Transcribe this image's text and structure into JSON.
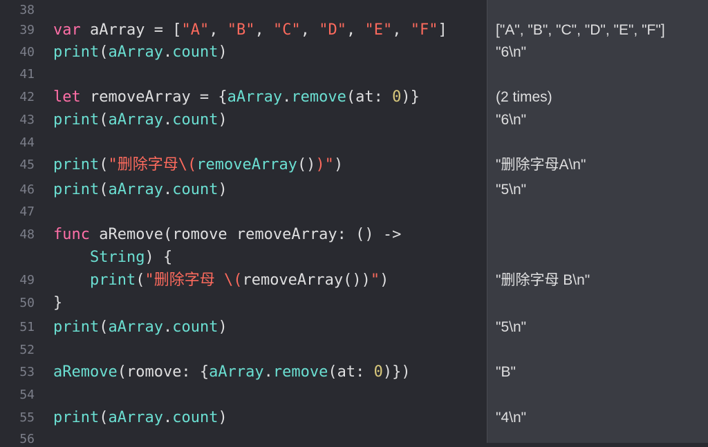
{
  "theme": {
    "editor_bg": "#292a30",
    "results_bg": "#3a3c43",
    "keyword": "#ff6fa7",
    "identifier": "#6bdfd2",
    "string": "#fc6a5d",
    "number": "#d9c97c",
    "plain": "#dfdfe0",
    "line_number": "#7c7f8a"
  },
  "lines": [
    {
      "num": "38",
      "tokens": []
    },
    {
      "num": "39",
      "tokens": [
        {
          "t": "var",
          "c": "kw"
        },
        {
          "t": " aArray = [",
          "c": "pl"
        },
        {
          "t": "\"A\"",
          "c": "str"
        },
        {
          "t": ", ",
          "c": "pl"
        },
        {
          "t": "\"B\"",
          "c": "str"
        },
        {
          "t": ", ",
          "c": "pl"
        },
        {
          "t": "\"C\"",
          "c": "str"
        },
        {
          "t": ", ",
          "c": "pl"
        },
        {
          "t": "\"D\"",
          "c": "str"
        },
        {
          "t": ", ",
          "c": "pl"
        },
        {
          "t": "\"E\"",
          "c": "str"
        },
        {
          "t": ", ",
          "c": "pl"
        },
        {
          "t": "\"F\"",
          "c": "str"
        },
        {
          "t": "]",
          "c": "pl"
        }
      ],
      "result": "[\"A\", \"B\", \"C\", \"D\", \"E\", \"F\"]"
    },
    {
      "num": "40",
      "tokens": [
        {
          "t": "print",
          "c": "id"
        },
        {
          "t": "(",
          "c": "pl"
        },
        {
          "t": "aArray",
          "c": "id"
        },
        {
          "t": ".",
          "c": "pl"
        },
        {
          "t": "count",
          "c": "id"
        },
        {
          "t": ")",
          "c": "pl"
        }
      ],
      "result": "\"6\\n\""
    },
    {
      "num": "41",
      "tokens": []
    },
    {
      "num": "42",
      "tokens": [
        {
          "t": "let",
          "c": "kw"
        },
        {
          "t": " removeArray = {",
          "c": "pl"
        },
        {
          "t": "aArray",
          "c": "id"
        },
        {
          "t": ".",
          "c": "pl"
        },
        {
          "t": "remove",
          "c": "id"
        },
        {
          "t": "(at: ",
          "c": "pl"
        },
        {
          "t": "0",
          "c": "num"
        },
        {
          "t": ")}",
          "c": "pl"
        }
      ],
      "result": "(2 times)"
    },
    {
      "num": "43",
      "tokens": [
        {
          "t": "print",
          "c": "id"
        },
        {
          "t": "(",
          "c": "pl"
        },
        {
          "t": "aArray",
          "c": "id"
        },
        {
          "t": ".",
          "c": "pl"
        },
        {
          "t": "count",
          "c": "id"
        },
        {
          "t": ")",
          "c": "pl"
        }
      ],
      "result": "\"6\\n\""
    },
    {
      "num": "44",
      "tokens": []
    },
    {
      "num": "45",
      "tokens": [
        {
          "t": "print",
          "c": "id"
        },
        {
          "t": "(",
          "c": "pl"
        },
        {
          "t": "\"删除字母\\(",
          "c": "str"
        },
        {
          "t": "removeArray",
          "c": "id"
        },
        {
          "t": "()",
          "c": "pl"
        },
        {
          "t": ")\"",
          "c": "str"
        },
        {
          "t": ")",
          "c": "pl"
        }
      ],
      "result": "\"删除字母A\\n\""
    },
    {
      "num": "46",
      "tokens": [
        {
          "t": "print",
          "c": "id"
        },
        {
          "t": "(",
          "c": "pl"
        },
        {
          "t": "aArray",
          "c": "id"
        },
        {
          "t": ".",
          "c": "pl"
        },
        {
          "t": "count",
          "c": "id"
        },
        {
          "t": ")",
          "c": "pl"
        }
      ],
      "result": "\"5\\n\""
    },
    {
      "num": "47",
      "tokens": []
    },
    {
      "num": "48",
      "tokens": [
        {
          "t": "func",
          "c": "kw"
        },
        {
          "t": " aRemove(romove removeArray: () ->",
          "c": "pl"
        }
      ]
    },
    {
      "num": "",
      "tokens": [
        {
          "t": "    ",
          "c": "pl"
        },
        {
          "t": "String",
          "c": "id"
        },
        {
          "t": ") {",
          "c": "pl"
        }
      ]
    },
    {
      "num": "49",
      "tokens": [
        {
          "t": "    ",
          "c": "pl"
        },
        {
          "t": "print",
          "c": "id"
        },
        {
          "t": "(",
          "c": "pl"
        },
        {
          "t": "\"删除字母 \\(",
          "c": "str"
        },
        {
          "t": "removeArray())",
          "c": "pl"
        },
        {
          "t": "\"",
          "c": "str"
        },
        {
          "t": ")",
          "c": "pl"
        }
      ],
      "result": "\"删除字母 B\\n\""
    },
    {
      "num": "50",
      "tokens": [
        {
          "t": "}",
          "c": "pl"
        }
      ]
    },
    {
      "num": "51",
      "tokens": [
        {
          "t": "print",
          "c": "id"
        },
        {
          "t": "(",
          "c": "pl"
        },
        {
          "t": "aArray",
          "c": "id"
        },
        {
          "t": ".",
          "c": "pl"
        },
        {
          "t": "count",
          "c": "id"
        },
        {
          "t": ")",
          "c": "pl"
        }
      ],
      "result": "\"5\\n\""
    },
    {
      "num": "52",
      "tokens": []
    },
    {
      "num": "53",
      "tokens": [
        {
          "t": "aRemove",
          "c": "id"
        },
        {
          "t": "(romove: {",
          "c": "pl"
        },
        {
          "t": "aArray",
          "c": "id"
        },
        {
          "t": ".",
          "c": "pl"
        },
        {
          "t": "remove",
          "c": "id"
        },
        {
          "t": "(at: ",
          "c": "pl"
        },
        {
          "t": "0",
          "c": "num"
        },
        {
          "t": ")})",
          "c": "pl"
        }
      ],
      "result": "\"B\""
    },
    {
      "num": "54",
      "tokens": []
    },
    {
      "num": "55",
      "tokens": [
        {
          "t": "print",
          "c": "id"
        },
        {
          "t": "(",
          "c": "pl"
        },
        {
          "t": "aArray",
          "c": "id"
        },
        {
          "t": ".",
          "c": "pl"
        },
        {
          "t": "count",
          "c": "id"
        },
        {
          "t": ")",
          "c": "pl"
        }
      ],
      "result": "\"4\\n\""
    },
    {
      "num": "56",
      "tokens": []
    }
  ]
}
